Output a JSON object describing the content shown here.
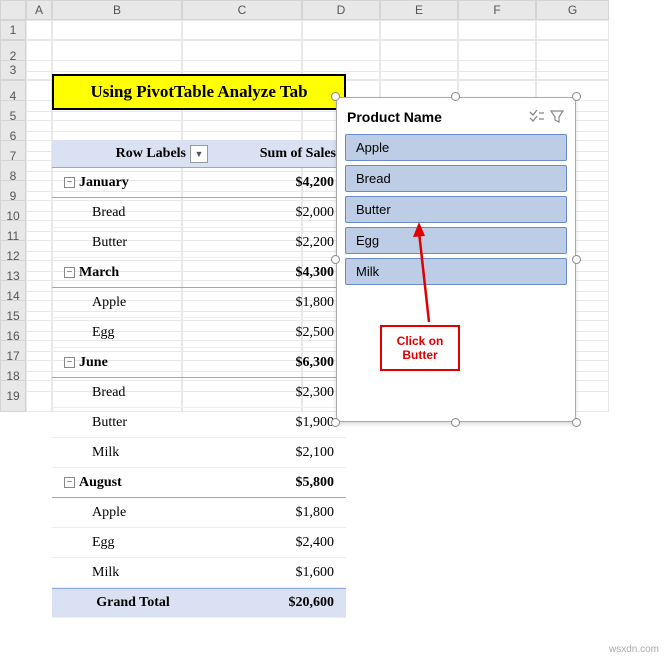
{
  "columns": [
    "",
    "A",
    "B",
    "C",
    "D",
    "E",
    "F",
    "G"
  ],
  "rows": [
    "1",
    "2",
    "3",
    "4",
    "5",
    "6",
    "7",
    "8",
    "9",
    "10",
    "11",
    "12",
    "13",
    "14",
    "15",
    "16",
    "17",
    "18",
    "19"
  ],
  "title": "Using PivotTable Analyze Tab",
  "pvt_header": {
    "label": "Row Labels",
    "sum": "Sum of Sales"
  },
  "pvt_data": [
    {
      "type": "group",
      "label": "January",
      "value": "$4,200",
      "expanded": true
    },
    {
      "type": "detail",
      "label": "Bread",
      "value": "$2,000"
    },
    {
      "type": "detail",
      "label": "Butter",
      "value": "$2,200"
    },
    {
      "type": "group",
      "label": "March",
      "value": "$4,300",
      "expanded": true
    },
    {
      "type": "detail",
      "label": "Apple",
      "value": "$1,800"
    },
    {
      "type": "detail",
      "label": "Egg",
      "value": "$2,500"
    },
    {
      "type": "group",
      "label": "June",
      "value": "$6,300",
      "expanded": true
    },
    {
      "type": "detail",
      "label": "Bread",
      "value": "$2,300"
    },
    {
      "type": "detail",
      "label": "Butter",
      "value": "$1,900"
    },
    {
      "type": "detail",
      "label": "Milk",
      "value": "$2,100"
    },
    {
      "type": "group",
      "label": "August",
      "value": "$5,800",
      "expanded": true
    },
    {
      "type": "detail",
      "label": "Apple",
      "value": "$1,800"
    },
    {
      "type": "detail",
      "label": "Egg",
      "value": "$2,400"
    },
    {
      "type": "detail",
      "label": "Milk",
      "value": "$1,600"
    },
    {
      "type": "total",
      "label": "Grand Total",
      "value": "$20,600"
    }
  ],
  "slicer": {
    "title": "Product Name",
    "items": [
      "Apple",
      "Bread",
      "Butter",
      "Egg",
      "Milk"
    ]
  },
  "callout_text": "Click on Butter",
  "watermark": "wsxdn.com"
}
